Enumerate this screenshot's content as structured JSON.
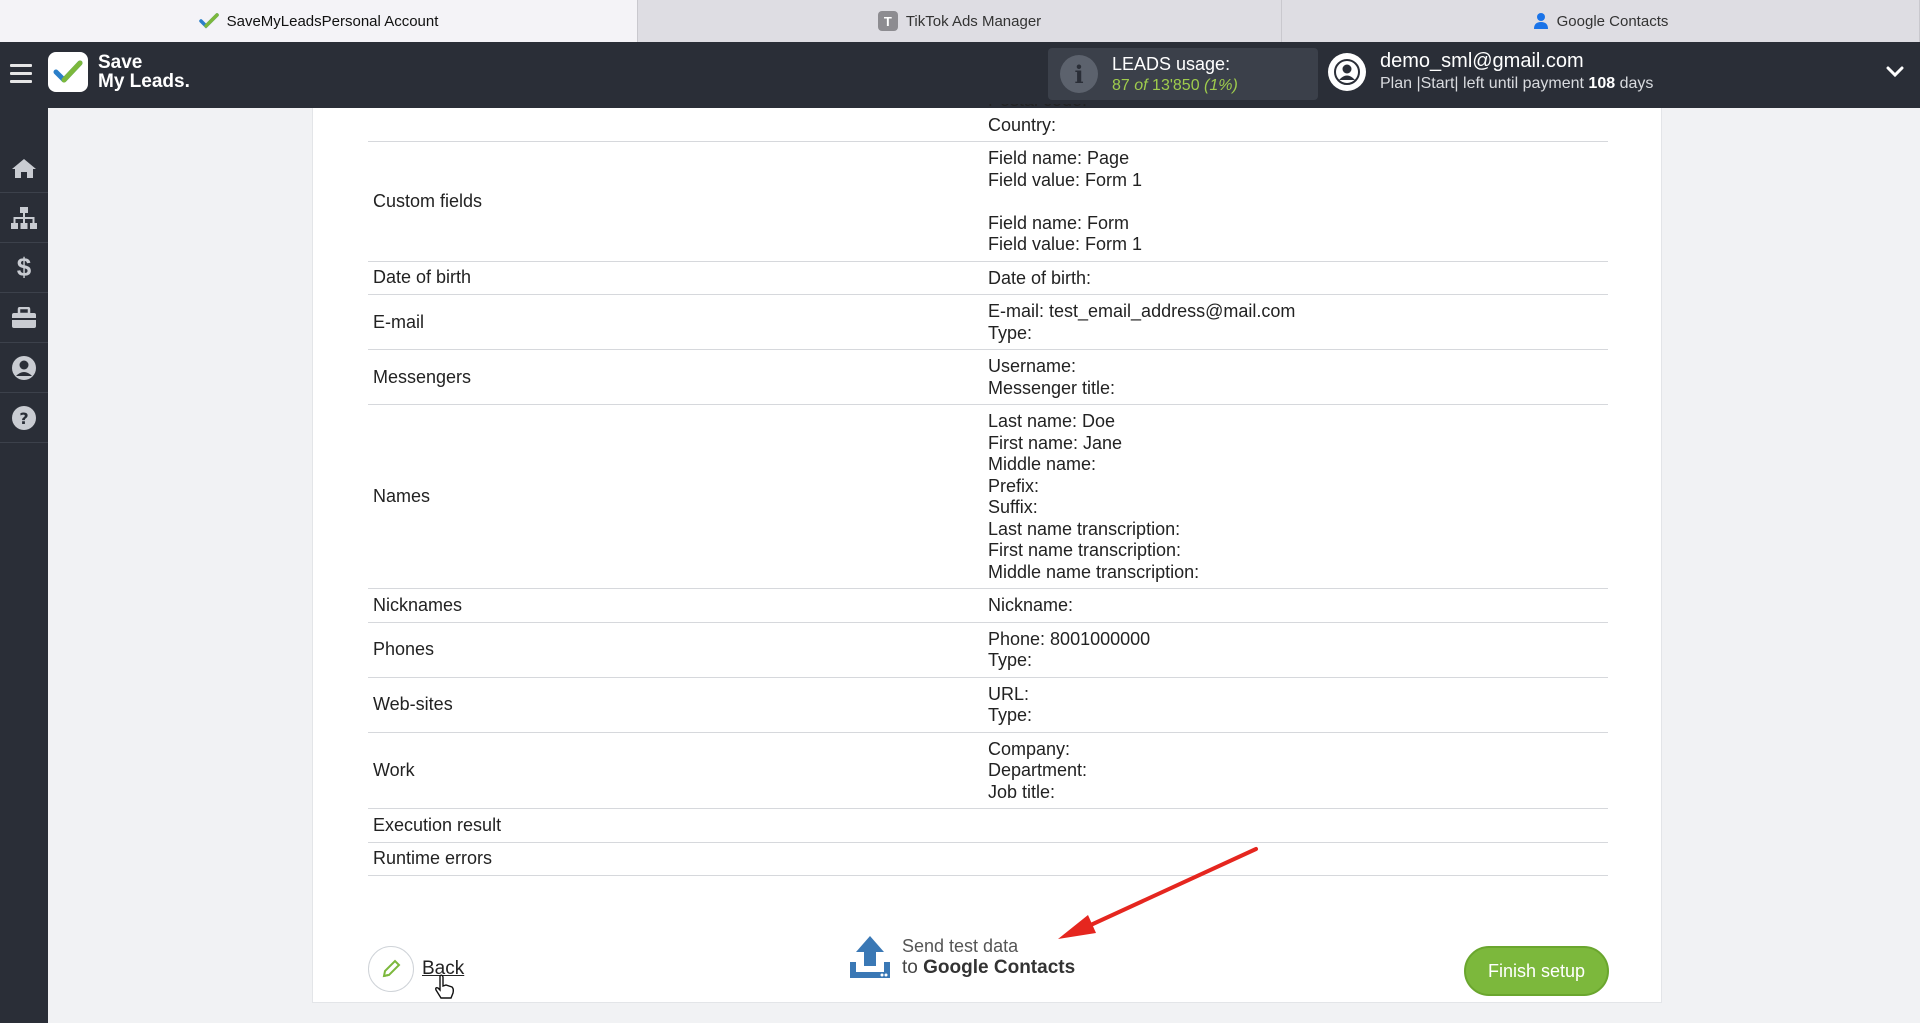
{
  "browser_tabs": [
    {
      "label": "SaveMyLeadsPersonal Account",
      "icon": "savemyleads-check-icon",
      "active": true
    },
    {
      "label": "TikTok Ads Manager",
      "icon": "tiktok-t-icon",
      "active": false
    },
    {
      "label": "Google Contacts",
      "icon": "google-contacts-person-icon",
      "active": false
    }
  ],
  "header": {
    "logo_line1": "Save",
    "logo_line2": "My Leads.",
    "leads_title": "LEADS usage:",
    "leads_used": "87",
    "leads_of": "of",
    "leads_total": "13'850",
    "leads_percent": "(1%)",
    "user_email": "demo_sml@gmail.com",
    "plan_text": "Plan |Start| left until payment",
    "plan_days": "108",
    "plan_days_unit": "days"
  },
  "sidebar": {
    "items": [
      "home-icon",
      "sitemap-icon",
      "dollar-icon",
      "briefcase-icon",
      "user-circle-icon",
      "help-icon"
    ]
  },
  "table": {
    "clipped_top_line": "Country:",
    "rows": [
      {
        "key": "Custom fields",
        "values": [
          "Field name: Page",
          "Field value: Form 1",
          "",
          "Field name: Form",
          "Field value: Form 1"
        ]
      },
      {
        "key": "Date of birth",
        "values": [
          "Date of birth:"
        ]
      },
      {
        "key": "E-mail",
        "values": [
          "E-mail: test_email_address@mail.com",
          "Type:"
        ]
      },
      {
        "key": "Messengers",
        "values": [
          "Username:",
          "Messenger title:"
        ]
      },
      {
        "key": "Names",
        "values": [
          "Last name: Doe",
          "First name: Jane",
          "Middle name:",
          "Prefix:",
          "Suffix:",
          "Last name transcription:",
          "First name transcription:",
          "Middle name transcription:"
        ]
      },
      {
        "key": "Nicknames",
        "values": [
          "Nickname:"
        ]
      },
      {
        "key": "Phones",
        "values": [
          "Phone: 8001000000",
          "Type:"
        ]
      },
      {
        "key": "Web-sites",
        "values": [
          "URL:",
          "Type:"
        ]
      },
      {
        "key": "Work",
        "values": [
          "Company:",
          "Department:",
          "Job title:"
        ]
      },
      {
        "key": "Execution result",
        "values": [
          ""
        ]
      },
      {
        "key": "Runtime errors",
        "values": [
          ""
        ]
      }
    ]
  },
  "footer": {
    "back_label": "Back",
    "send_line1": "Send test data",
    "send_line2_prefix": "to",
    "send_line2_target": "Google Contacts",
    "finish_label": "Finish setup"
  },
  "colors": {
    "header_bg": "#2a2e37",
    "accent_green": "#7cb83c",
    "leads_green": "#9fcc4d",
    "annotation_arrow": "#e5261f",
    "upload_icon": "#3a78b5"
  }
}
